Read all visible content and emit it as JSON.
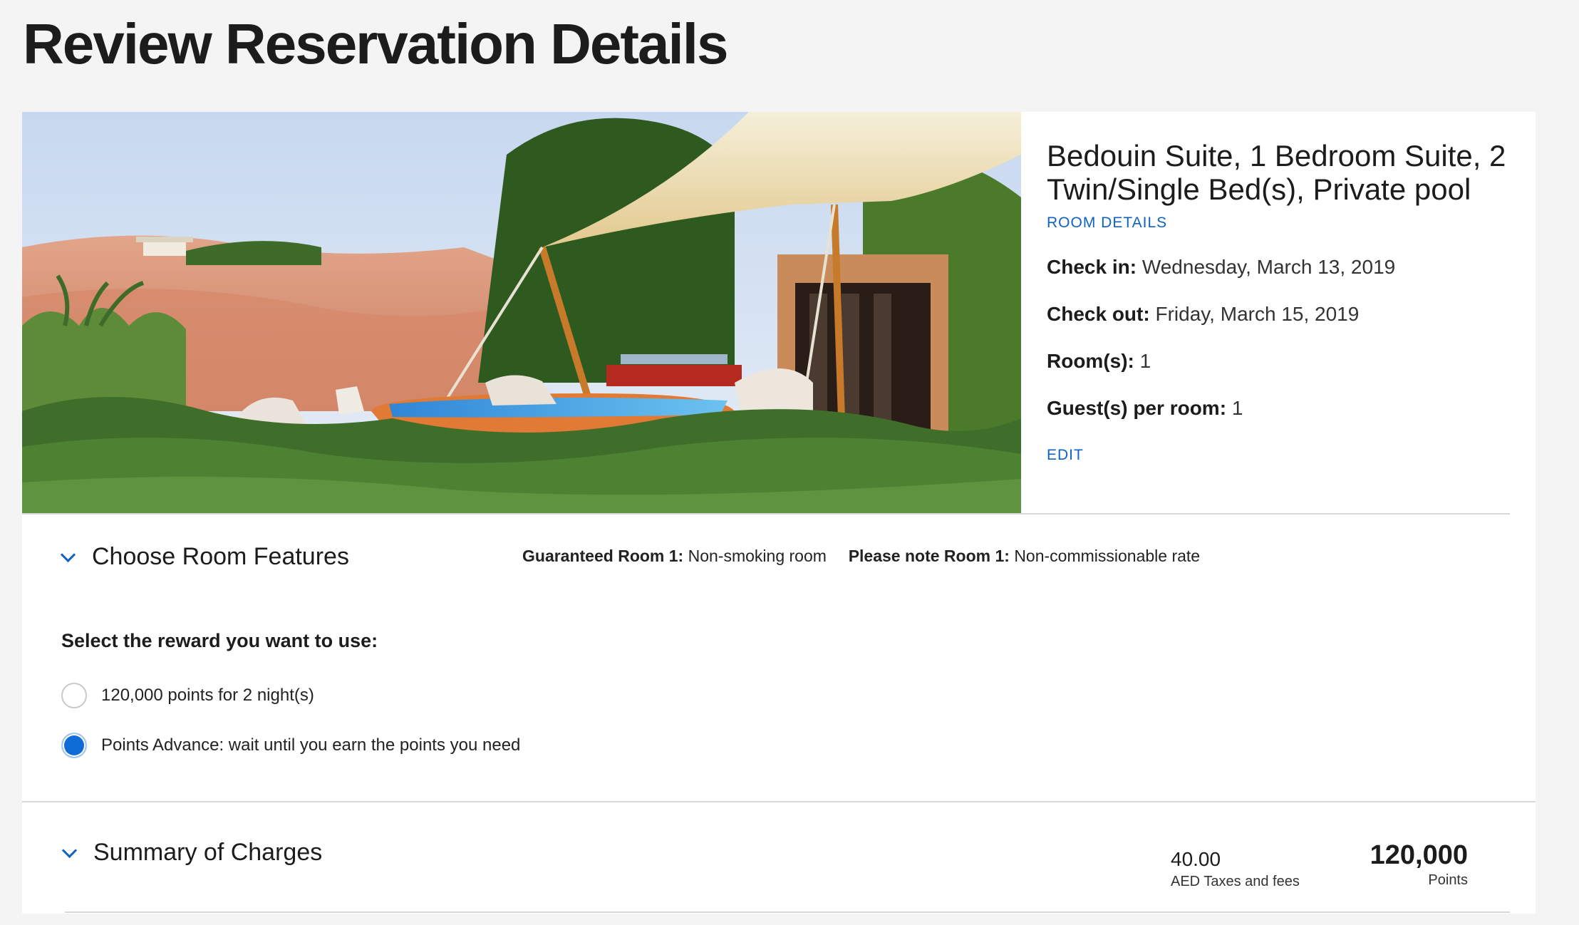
{
  "page": {
    "title": "Review Reservation Details"
  },
  "room": {
    "name": "Bedouin Suite, 1 Bedroom Suite, 2 Twin/Single Bed(s), Private pool",
    "details_link": "ROOM DETAILS",
    "check_in_label": "Check in:",
    "check_in_value": "Wednesday, March 13, 2019",
    "check_out_label": "Check out:",
    "check_out_value": "Friday, March 15, 2019",
    "rooms_label": "Room(s):",
    "rooms_value": "1",
    "guests_label": "Guest(s) per room:",
    "guests_value": "1",
    "edit_link": "EDIT"
  },
  "features": {
    "title": "Choose Room Features",
    "guaranteed_label": "Guaranteed Room 1:",
    "guaranteed_value": "Non-smoking room",
    "note_label": "Please note Room 1:",
    "note_value": "Non-commissionable rate"
  },
  "reward": {
    "question": "Select the reward you want to use:",
    "options": [
      {
        "label": "120,000 points for 2 night(s)",
        "selected": false
      },
      {
        "label": "Points Advance: wait until you earn the points you need",
        "selected": true
      }
    ]
  },
  "summary": {
    "title": "Summary of Charges",
    "taxes_amount": "40.00",
    "taxes_caption": "AED Taxes and fees",
    "points_amount": "120,000",
    "points_caption": "Points"
  },
  "colors": {
    "accent": "#0f62c0",
    "selected_radio": "#0f6bd6"
  },
  "icons": {
    "section_toggle": "chevron-down-icon"
  }
}
